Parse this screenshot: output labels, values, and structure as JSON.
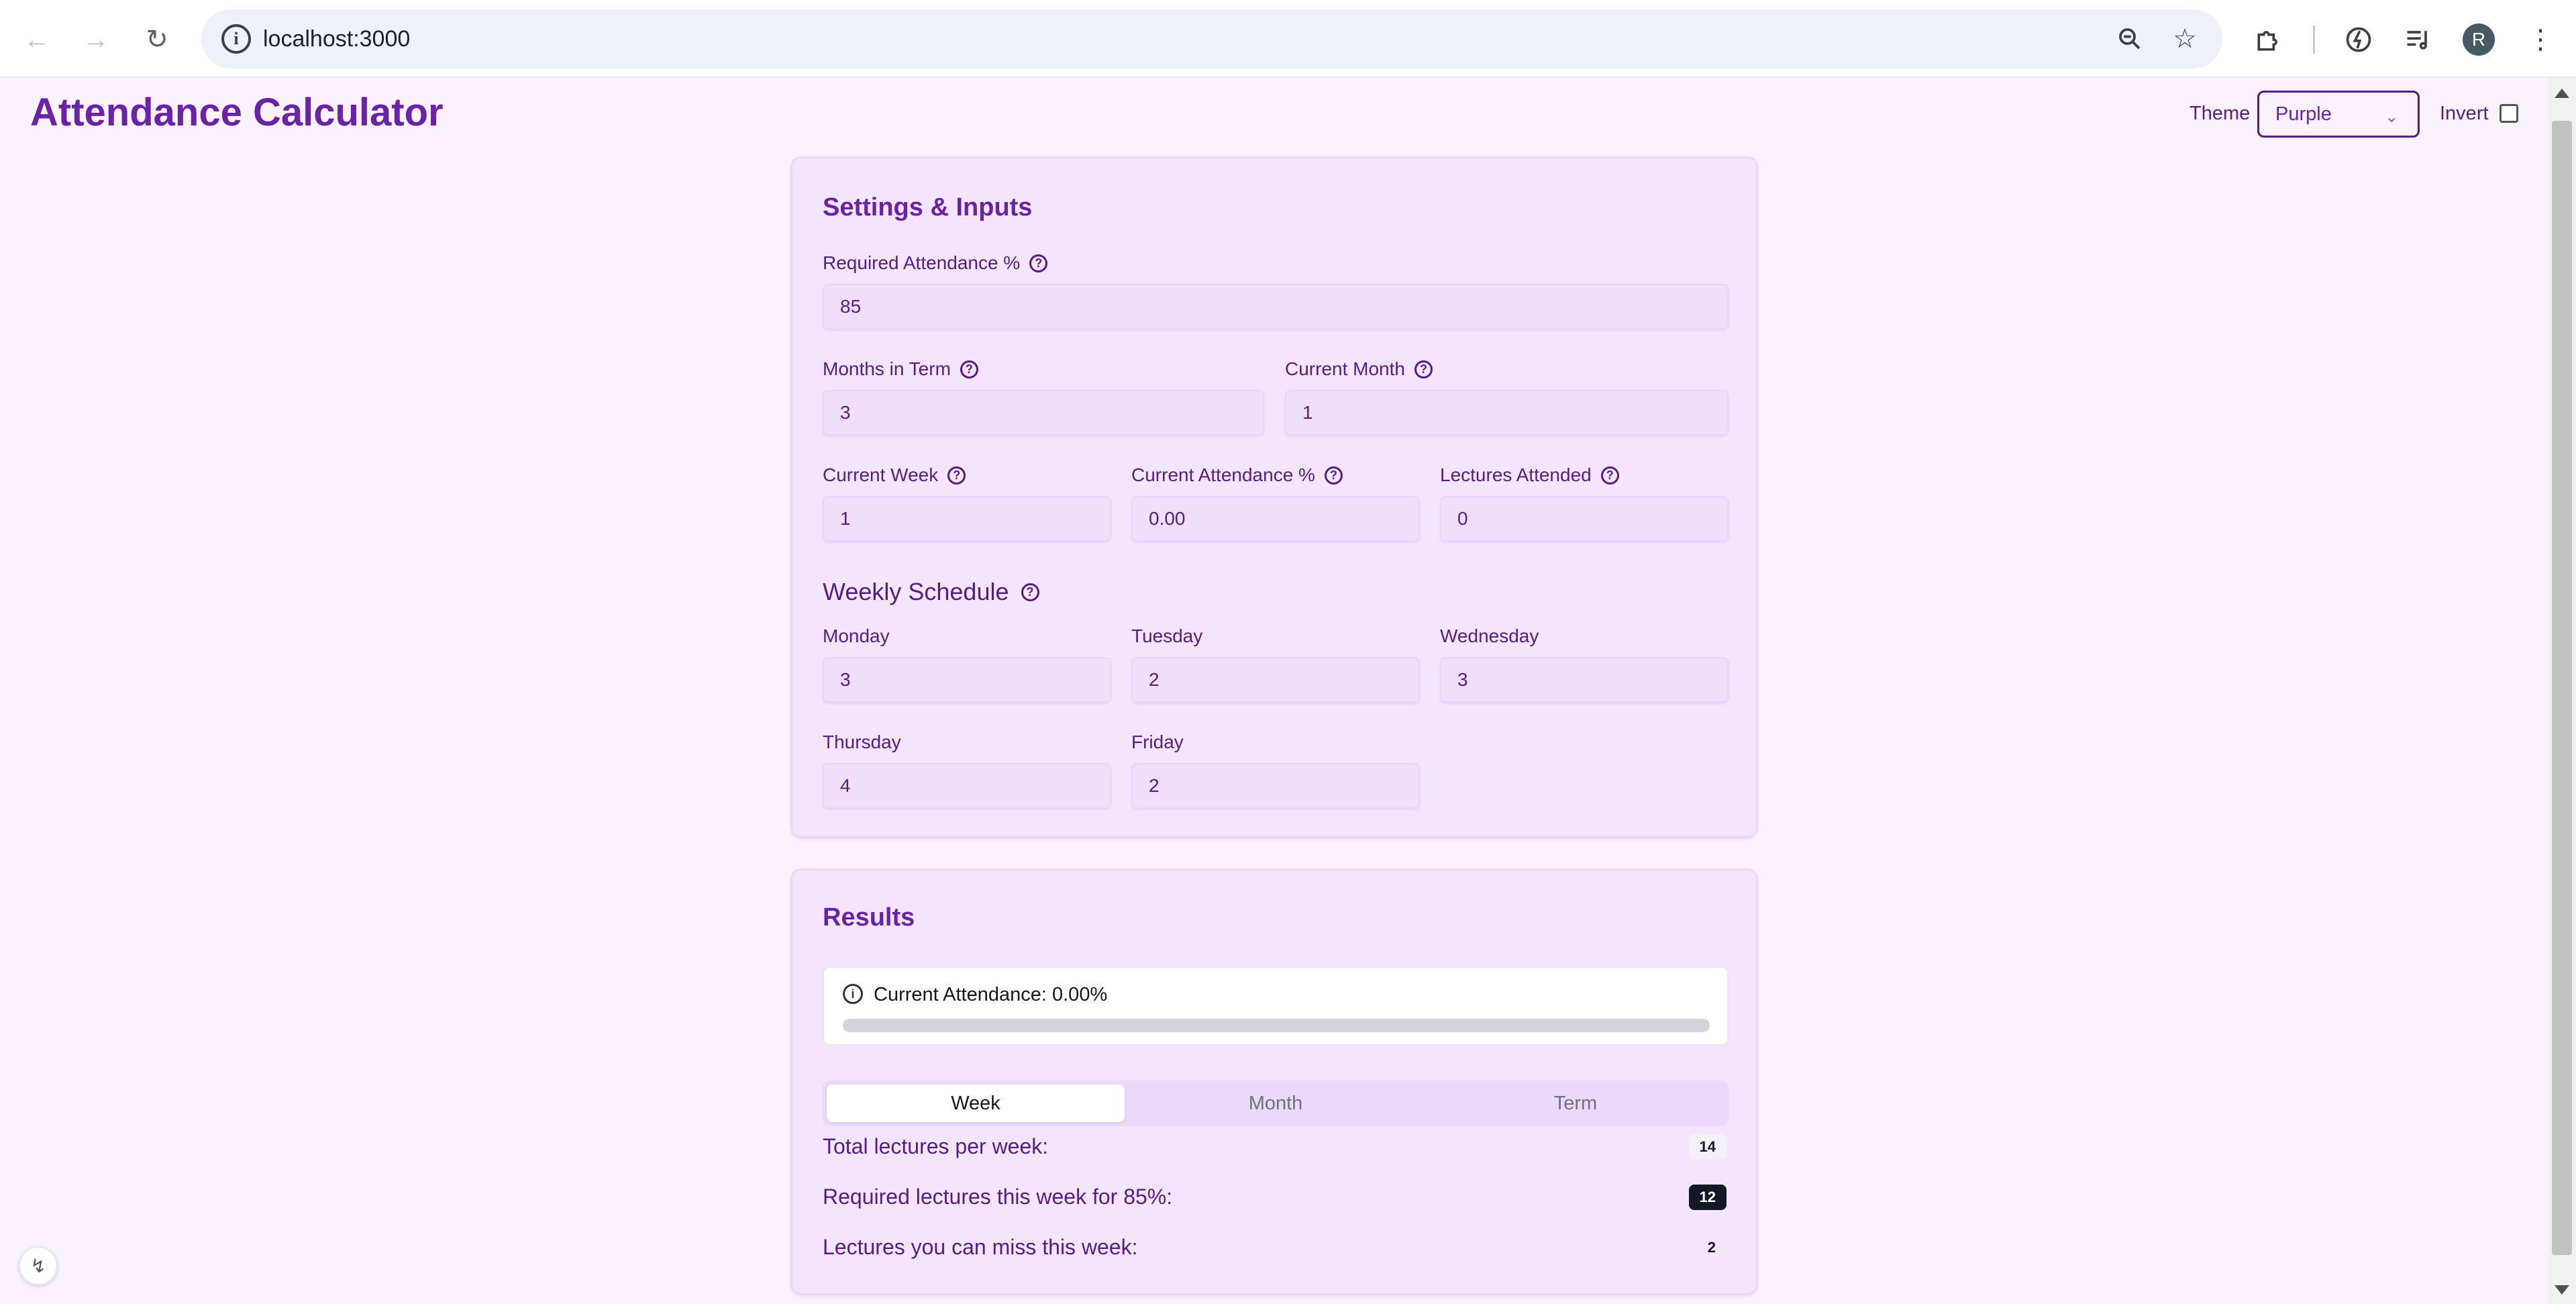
{
  "browser": {
    "url": "localhost:3000",
    "avatar_letter": "R"
  },
  "header": {
    "title": "Attendance Calculator",
    "theme_label": "Theme",
    "theme_value": "Purple",
    "invert_label": "Invert",
    "invert_checked": false
  },
  "settings": {
    "title": "Settings & Inputs",
    "required_attendance": {
      "label": "Required Attendance %",
      "value": "85"
    },
    "months_in_term": {
      "label": "Months in Term",
      "value": "3"
    },
    "current_month": {
      "label": "Current Month",
      "value": "1"
    },
    "current_week": {
      "label": "Current Week",
      "value": "1"
    },
    "current_attendance": {
      "label": "Current Attendance %",
      "value": "0.00"
    },
    "lectures_attended": {
      "label": "Lectures Attended",
      "value": "0"
    },
    "weekly_schedule_title": "Weekly Schedule",
    "days": [
      {
        "label": "Monday",
        "value": "3"
      },
      {
        "label": "Tuesday",
        "value": "2"
      },
      {
        "label": "Wednesday",
        "value": "3"
      },
      {
        "label": "Thursday",
        "value": "4"
      },
      {
        "label": "Friday",
        "value": "2"
      }
    ]
  },
  "results": {
    "title": "Results",
    "current_attendance_text": "Current Attendance: 0.00%",
    "current_attendance_progress": 0.0,
    "tabs": [
      {
        "label": "Week",
        "active": true
      },
      {
        "label": "Month",
        "active": false
      },
      {
        "label": "Term",
        "active": false
      }
    ],
    "rows": [
      {
        "label": "Total lectures per week:",
        "value": "14",
        "style": "light"
      },
      {
        "label": "Required lectures this week for 85%:",
        "value": "12",
        "style": "dark"
      },
      {
        "label": "Lectures you can miss this week:",
        "value": "2",
        "style": "plain"
      }
    ]
  },
  "colors": {
    "accent": "#6b21a8",
    "text": "#581c87",
    "card_bg": "#f3e5fd",
    "page_bg": "#faf3fe"
  }
}
